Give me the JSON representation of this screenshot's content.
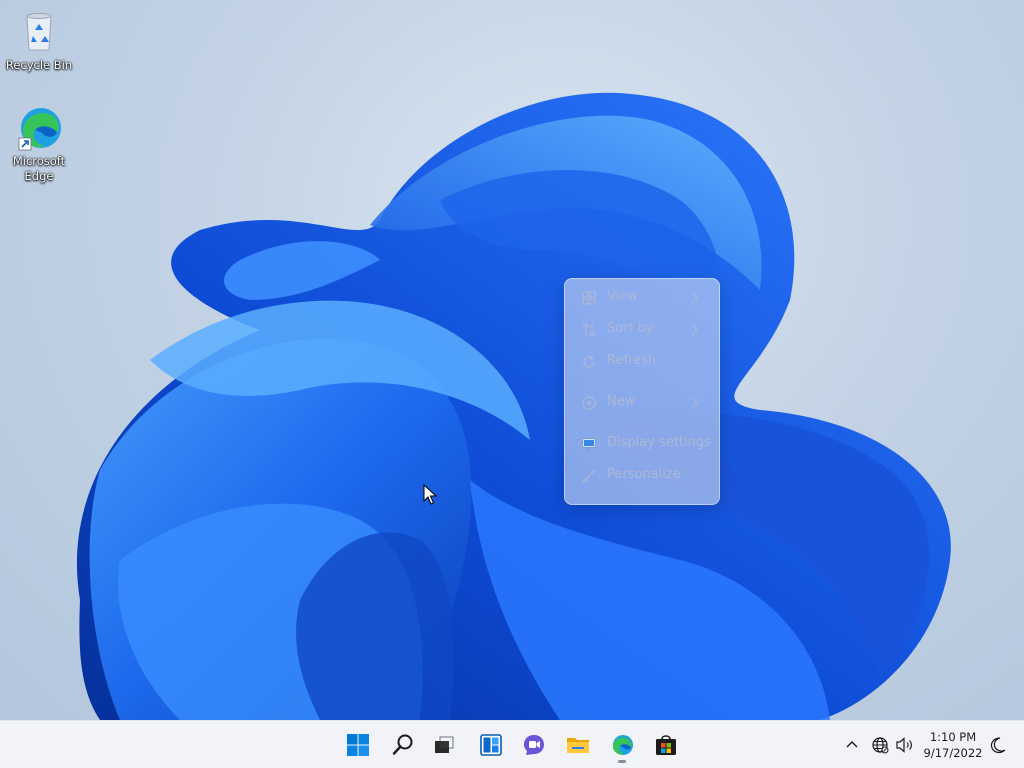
{
  "desktop": {
    "icons": [
      {
        "label": "Recycle Bin",
        "icon": "recycle-bin-icon"
      },
      {
        "label": "Microsoft Edge",
        "icon": "edge-icon"
      }
    ]
  },
  "context_menu": {
    "items": [
      {
        "label": "View",
        "icon": "grid-icon",
        "has_submenu": true
      },
      {
        "label": "Sort by",
        "icon": "sort-icon",
        "has_submenu": true
      },
      {
        "label": "Refresh",
        "icon": "refresh-icon",
        "has_submenu": false
      },
      {
        "label": "New",
        "icon": "plus-circle-icon",
        "has_submenu": true
      },
      {
        "label": "Display settings",
        "icon": "display-icon",
        "has_submenu": false
      },
      {
        "label": "Personalize",
        "icon": "brush-icon",
        "has_submenu": false
      }
    ]
  },
  "taskbar": {
    "apps": [
      {
        "name": "start",
        "icon": "windows-logo-icon"
      },
      {
        "name": "search",
        "icon": "search-icon"
      },
      {
        "name": "task-view",
        "icon": "task-view-icon"
      },
      {
        "name": "widgets",
        "icon": "widgets-icon"
      },
      {
        "name": "chat",
        "icon": "chat-icon"
      },
      {
        "name": "file-explorer",
        "icon": "folder-icon"
      },
      {
        "name": "edge",
        "icon": "edge-icon",
        "running": true
      },
      {
        "name": "store",
        "icon": "store-icon"
      }
    ],
    "tray": {
      "time": "1:10 PM",
      "date": "9/17/2022"
    }
  },
  "colors": {
    "accent": "#0067c0",
    "taskbar_bg": "#f1f3f9",
    "menu_text": "#aeb8d4"
  }
}
